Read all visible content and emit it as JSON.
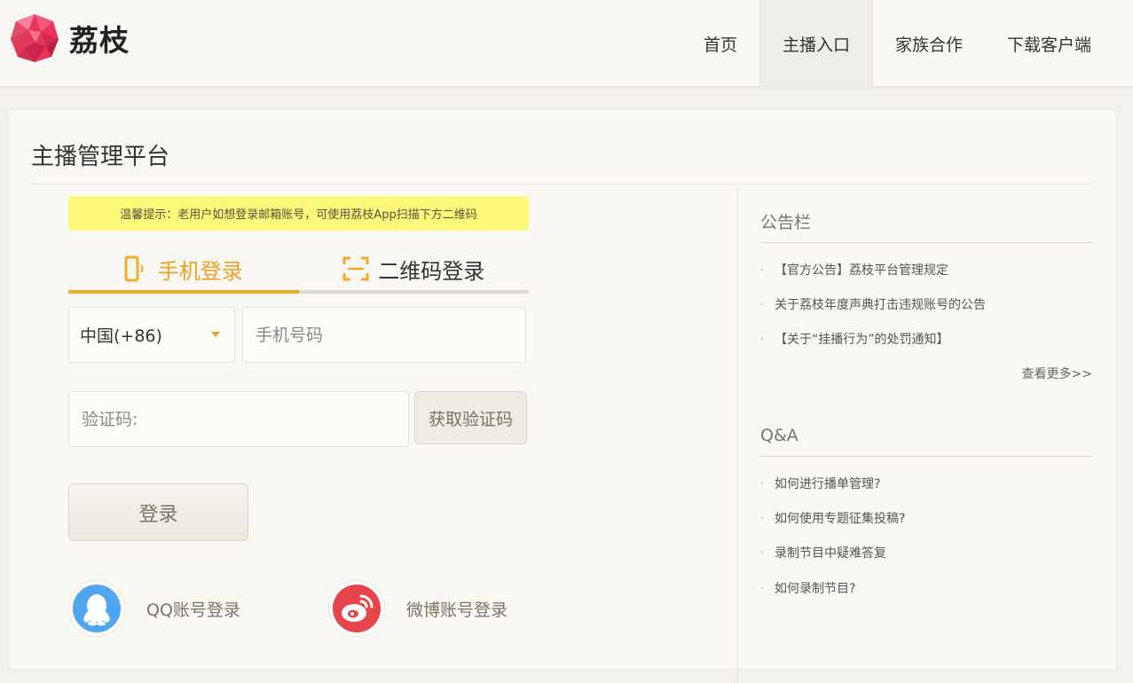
{
  "header": {
    "logo_text": "荔枝",
    "nav": [
      {
        "label": "首页",
        "active": false
      },
      {
        "label": "主播入口",
        "active": true
      },
      {
        "label": "家族合作",
        "active": false
      },
      {
        "label": "下载客户端",
        "active": false
      }
    ]
  },
  "page": {
    "title": "主播管理平台"
  },
  "login": {
    "notice": "温馨提示：老用户如想登录邮箱账号，可使用荔枝App扫描下方二维码",
    "tabs": {
      "phone": "手机登录",
      "qrcode": "二维码登录",
      "active": "phone"
    },
    "country_code": "中国(+86)",
    "phone_placeholder": "手机号码",
    "code_placeholder": "验证码:",
    "get_code_label": "获取验证码",
    "submit_label": "登录",
    "qq_label": "QQ账号登录",
    "weibo_label": "微博账号登录"
  },
  "sidebar": {
    "announcements": {
      "title": "公告栏",
      "items": [
        "【官方公告】荔枝平台管理规定",
        "关于荔枝年度声典打击违规账号的公告",
        "【关于“挂播行为”的处罚通知】"
      ],
      "more": "查看更多>>"
    },
    "qa": {
      "title": "Q&A",
      "items": [
        "如何进行播单管理?",
        "如何使用专题征集投稿?",
        "录制节目中疑难答复",
        "如何录制节目?"
      ]
    }
  },
  "colors": {
    "accent": "#f3aa2a",
    "notice_bg": "#fcf97a",
    "brand_red": "#e8365a",
    "weibo_red": "#e6454c",
    "qq_blue": "#4fa6ee"
  }
}
